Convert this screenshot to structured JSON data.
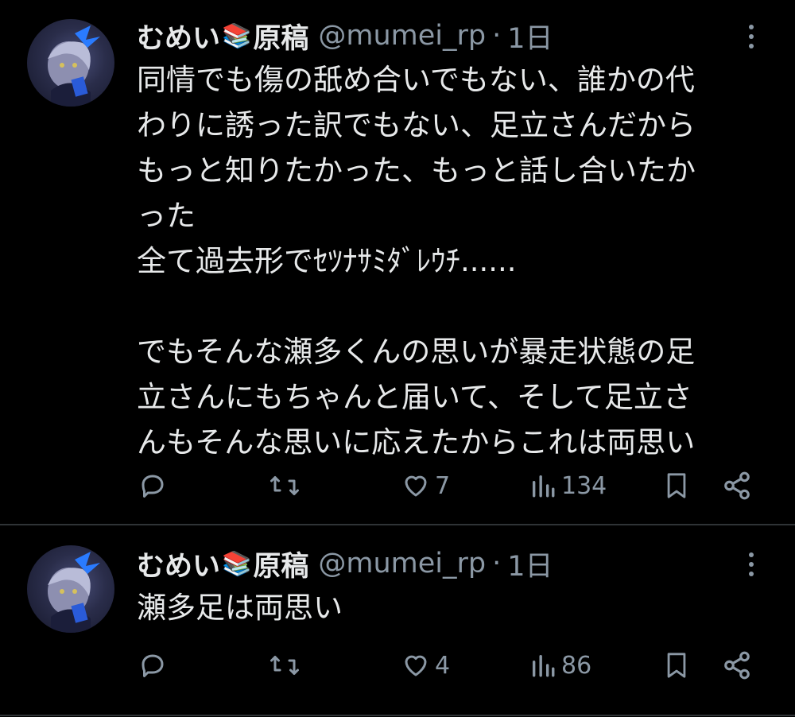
{
  "tweets": [
    {
      "author_name": "むめい",
      "author_name_suffix": "原稿",
      "books_emoji": "📚",
      "handle": "@mumei_rp",
      "separator": "·",
      "time": "1日",
      "lines": [
        "同情でも傷の舐め合いでもない、誰かの代",
        "わりに誘った訳でもない、足立さんだから",
        "もっと知りたかった、もっと話し合いたか",
        "った",
        "全て過去形でｾﾂﾅｻﾐﾀﾞﾚｳﾁ......",
        "",
        "でもそんな瀬多くんの思いが暴走状態の足",
        "立さんにもちゃんと届いて、そして足立さ",
        "んもそんな思いに応えたからこれは両思い"
      ],
      "likes": "7",
      "views": "134"
    },
    {
      "author_name": "むめい",
      "author_name_suffix": "原稿",
      "books_emoji": "📚",
      "handle": "@mumei_rp",
      "separator": "·",
      "time": "1日",
      "lines": [
        "瀬多足は両思い"
      ],
      "likes": "4",
      "views": "86"
    }
  ],
  "icons": {
    "reply": "reply-icon",
    "retweet": "retweet-icon",
    "like": "heart-icon",
    "views": "views-bar-chart-icon",
    "bookmark": "bookmark-icon",
    "share": "share-icon",
    "more": "more-vertical-icon"
  },
  "colors": {
    "background": "#000000",
    "text": "#e7e9ea",
    "muted": "#8b98a5",
    "divider": "#2f3336"
  }
}
